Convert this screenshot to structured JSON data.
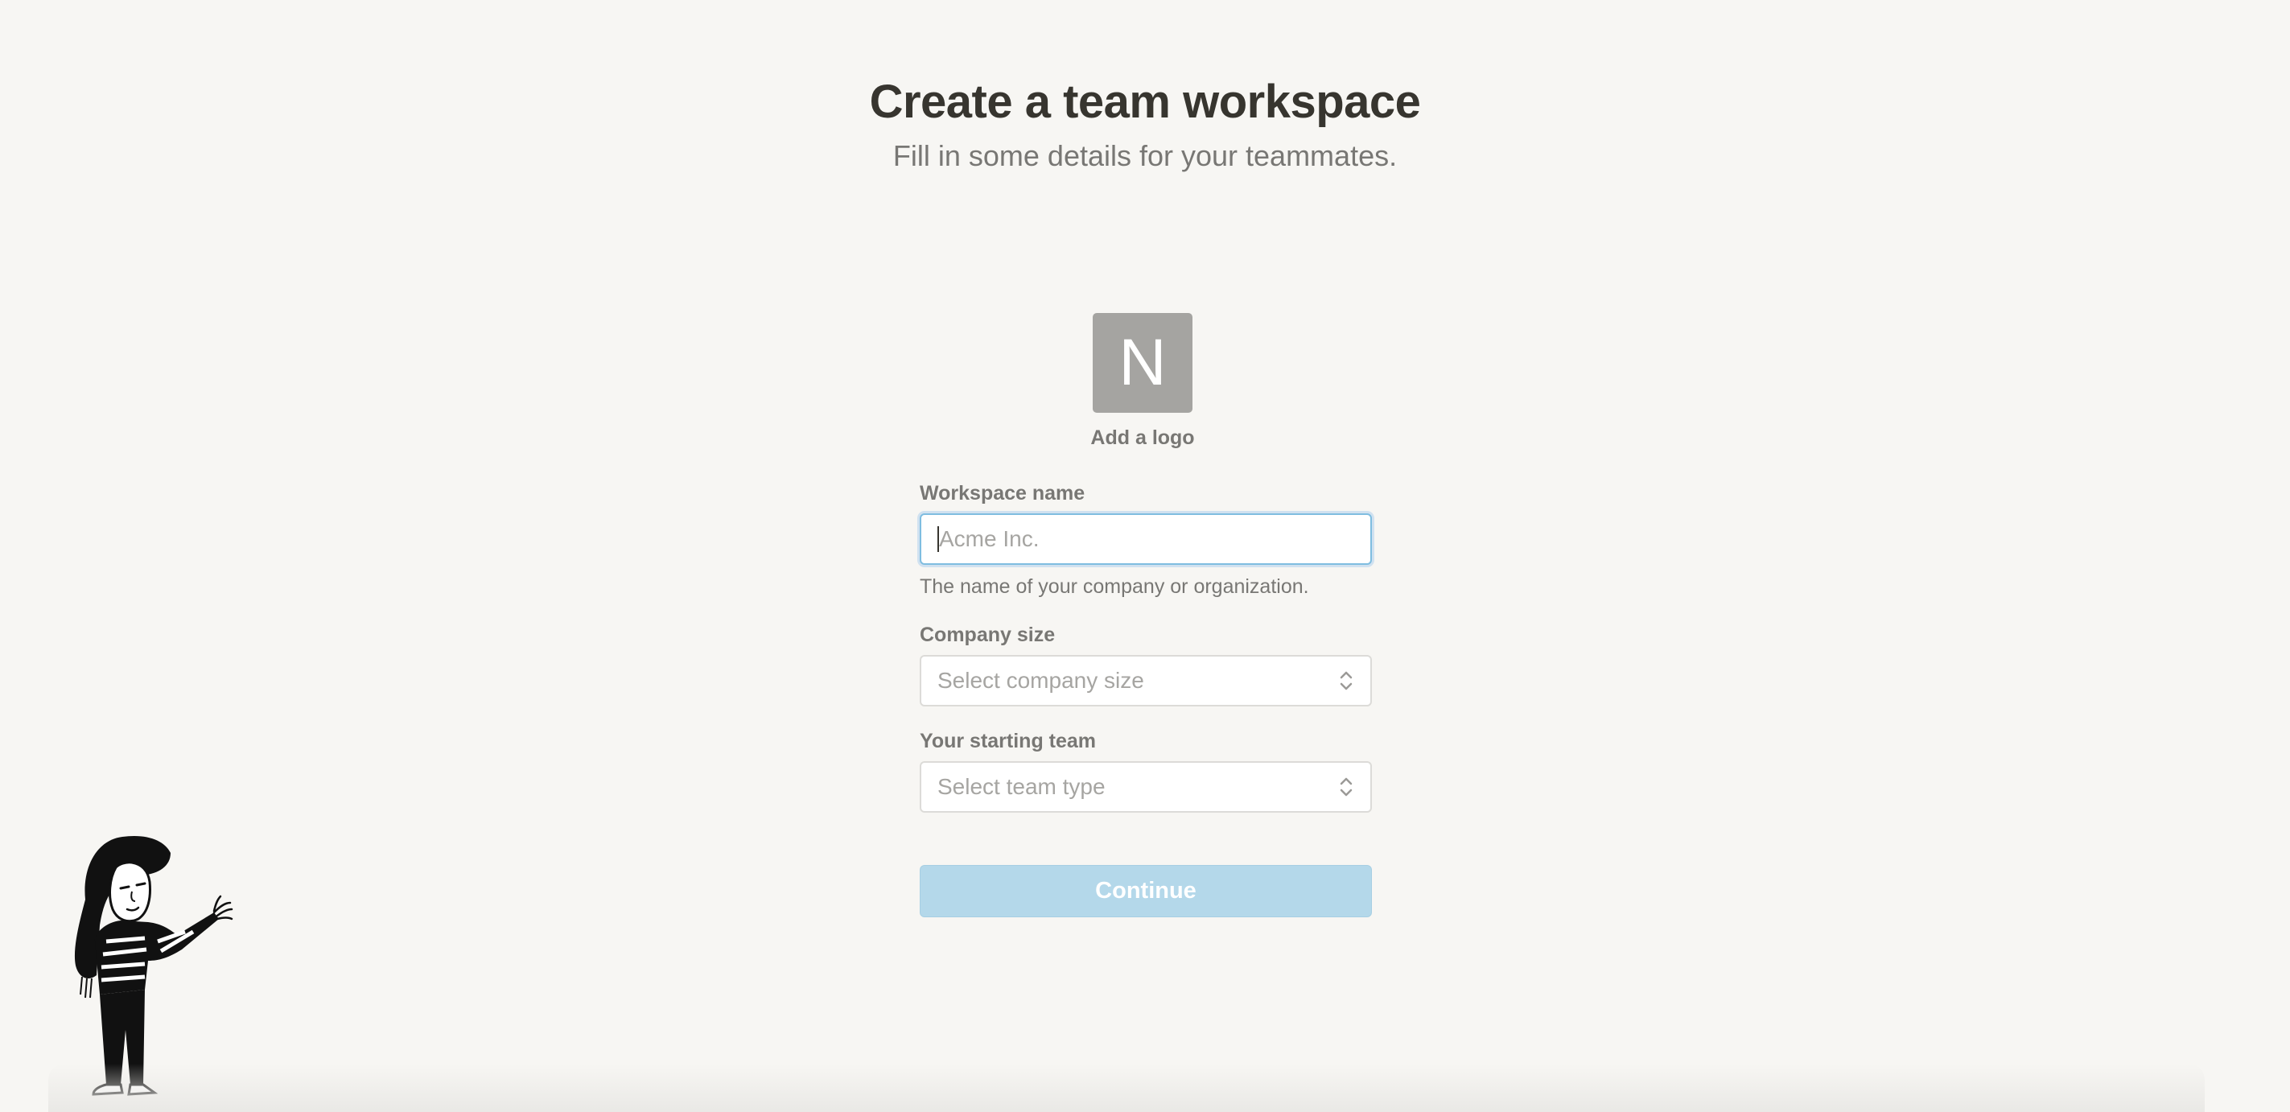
{
  "header": {
    "title": "Create a team workspace",
    "subtitle": "Fill in some details for your teammates."
  },
  "logo": {
    "initial": "N",
    "add_label": "Add a logo"
  },
  "form": {
    "workspace_name": {
      "label": "Workspace name",
      "value": "",
      "placeholder": "Acme Inc.",
      "help": "The name of your company or organization."
    },
    "company_size": {
      "label": "Company size",
      "placeholder": "Select company size"
    },
    "starting_team": {
      "label": "Your starting team",
      "placeholder": "Select team type"
    },
    "continue_label": "Continue"
  },
  "colors": {
    "background": "#f7f6f3",
    "logo_tile": "#a5a4a1",
    "focus_border": "#7fbde0",
    "continue_disabled": "#b4d8ea",
    "muted_text": "#787774"
  },
  "icons": {
    "select_chevrons": "chevron-up-down-icon",
    "illustration": "waving-person-illustration"
  }
}
